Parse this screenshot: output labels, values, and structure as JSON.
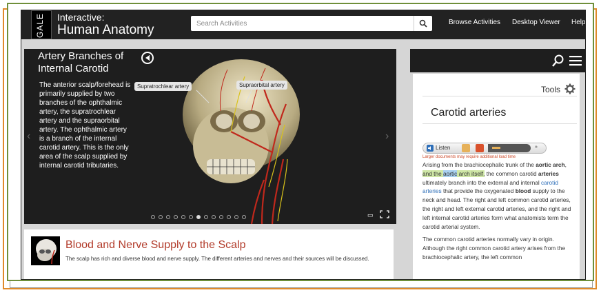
{
  "app": {
    "gale_logo": "GALE",
    "title_line1": "Interactive:",
    "title_line2": "Human Anatomy"
  },
  "search": {
    "placeholder": "Search Activities"
  },
  "nav": {
    "items": [
      "Browse Activities",
      "Desktop Viewer",
      "Help"
    ]
  },
  "hero": {
    "title": "Artery Branches of Internal Carotid",
    "text": "The anterior scalp/forehead is primarily supplied by two branches of the ophthalmic artery, the supratrochlear artery and the supraorbital artery. The ophthalmic artery is a branch of the internal carotid artery. This is the only area of the scalp supplied by internal carotid tributaries.",
    "labels": {
      "supratrochlear": "Supratrochlear artery",
      "supraorbital": "Supraorbital artery"
    },
    "slides": {
      "count": 13,
      "active": 6
    }
  },
  "card": {
    "title": "Blood and Nerve Supply to the Scalp",
    "text": "The scalp has rich and diverse blood and nerve supply. The different arteries and nerves and their sources will be discussed."
  },
  "side": {
    "tools_label": "Tools",
    "title": "Carotid arteries",
    "listen_label": "Listen",
    "listen_note": "Larger documents may require additional load time",
    "para1": {
      "t1": "Arising from the brachiocephalic trunk of the ",
      "b1": "aortic arch",
      "t2": ", ",
      "h1": "and the ",
      "h2": "aortic",
      "h3": " arch itself,",
      "t3": " the common carotid ",
      "b2": "arteries",
      "t4": " ultimately branch into the external and internal ",
      "l1": "carotid arteries",
      "t5": " that provide the oxygenated ",
      "b3": "blood",
      "t6": " supply to the neck and head. The right and left common carotid arteries, the right and left external carotid arteries, and the right and left internal carotid arteries form what anatomists term the carotid arterial system."
    },
    "para2": "The common carotid arteries normally vary in origin. Although the right common carotid artery arises from the brachiocephalic artery, the left common"
  },
  "colors": {
    "accent_title": "#b23b2a",
    "highlight_green": "#cfe7a6",
    "highlight_blue": "#a9d1f0",
    "link": "#2d6eb8"
  },
  "icons": [
    "search-icon",
    "menu-icon",
    "gear-icon",
    "pause-play-icon",
    "fullscreen-icon",
    "caption-icon"
  ]
}
